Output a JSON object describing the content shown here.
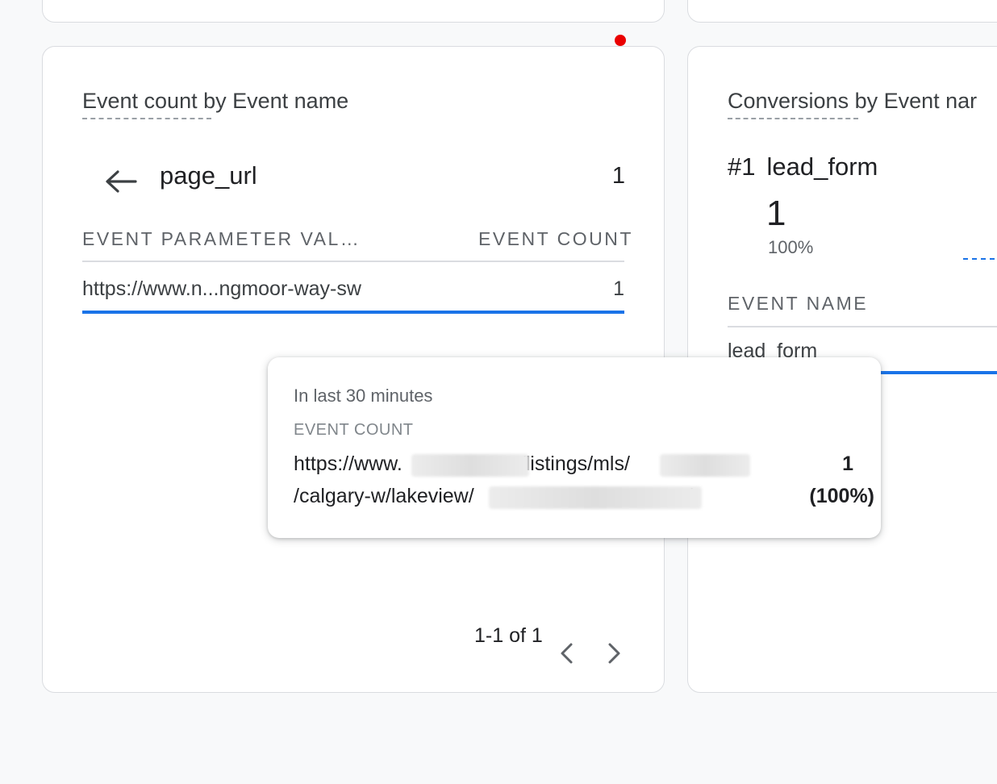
{
  "left_card": {
    "title": "Event count by Event name",
    "dimension": {
      "name": "page_url",
      "count": "1"
    },
    "columns": {
      "param": "EVENT PARAMETER VAL…",
      "count": "EVENT COUNT"
    },
    "rows": [
      {
        "value": "https://www.n...ngmoor-way-sw",
        "count": "1"
      }
    ],
    "pagination": {
      "label": "1-1 of 1"
    }
  },
  "right_card": {
    "title": "Conversions by Event nar",
    "top_item": {
      "rank": "#1",
      "name": "lead_form",
      "value": "1",
      "percent": "100%"
    },
    "column": "EVENT NAME",
    "rows": [
      {
        "name": "lead_form"
      }
    ]
  },
  "tooltip": {
    "period": "In last 30 minutes",
    "metric": "EVENT COUNT",
    "line1_prefix": "https://www.",
    "line1_mid": "/listings/mls/",
    "line2_prefix": "/calgary-w/lakeview/",
    "line2_suffix": "/",
    "value": "1",
    "percent": "(100%)"
  },
  "colors": {
    "accent": "#1a73e8",
    "notification_dot": "#ea0000",
    "card_border": "#dadce0"
  },
  "icons": {
    "back": "arrow-left-icon",
    "prev": "chevron-left-icon",
    "next": "chevron-right-icon"
  }
}
